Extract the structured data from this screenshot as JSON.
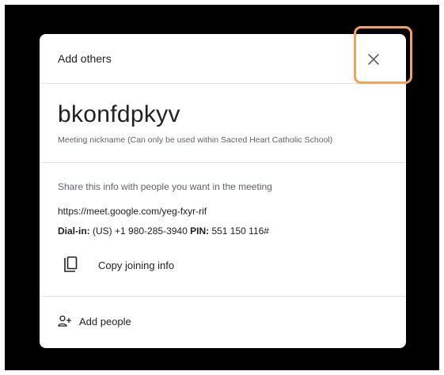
{
  "dialog": {
    "title": "Add others",
    "meeting_name": "bkonfdpkyv",
    "nickname_caption": "Meeting nickname (Can only be used within Sacred Heart Catholic School)",
    "share_hint": "Share this info with people you want in the meeting",
    "meet_link": "https://meet.google.com/yeg-fxyr-rif",
    "dialin": {
      "label": "Dial-in:",
      "number": "(US) +1 980-285-3940",
      "pin_label": "PIN:",
      "pin": "551 150 116#"
    },
    "copy_button": {
      "label": "Copy joining info",
      "icon": "copy-icon"
    },
    "add_people": {
      "label": "Add people",
      "icon": "person-add-icon"
    },
    "close_icon": "close-icon"
  },
  "colors": {
    "backdrop": "#000000",
    "highlight": "#f4a155",
    "text_primary": "#202124",
    "text_secondary": "#5f6368"
  }
}
